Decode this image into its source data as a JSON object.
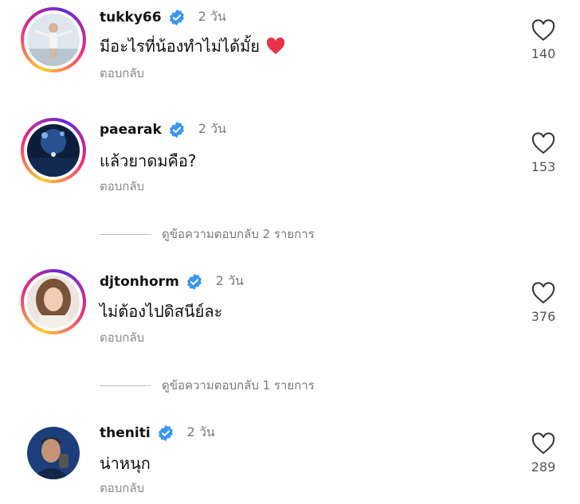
{
  "comments": [
    {
      "username": "tukky66",
      "time": "2 วัน",
      "text": "มีอะไรที่น้องทำไม่ได้มั้ย",
      "emoji": "heart-emoji",
      "reply_label": "ตอบกลับ",
      "likes": "140"
    },
    {
      "username": "paearak",
      "time": "2 วัน",
      "text": "แล้วยาดมคือ?",
      "reply_label": "ตอบกลับ",
      "likes": "153"
    },
    {
      "username": "djtonhorm",
      "time": "2 วัน",
      "text": "ไม่ต้องไปดิสนีย์ละ",
      "reply_label": "ตอบกลับ",
      "likes": "376"
    },
    {
      "username": "theniti",
      "time": "2 วัน",
      "text": "น่าหนุก",
      "reply_label": "ตอบกลับ",
      "likes": "289"
    }
  ],
  "view_replies": [
    {
      "label": "ดูข้อความตอบกลับ 2 รายการ"
    },
    {
      "label": "ดูข้อความตอบกลับ 1 รายการ"
    }
  ],
  "colors": {
    "verified": "#3897f0",
    "emoji_heart": "#e8334a",
    "ring_start": "#f9ce34",
    "ring_mid": "#ee2a7b",
    "ring_end": "#6228d7"
  }
}
